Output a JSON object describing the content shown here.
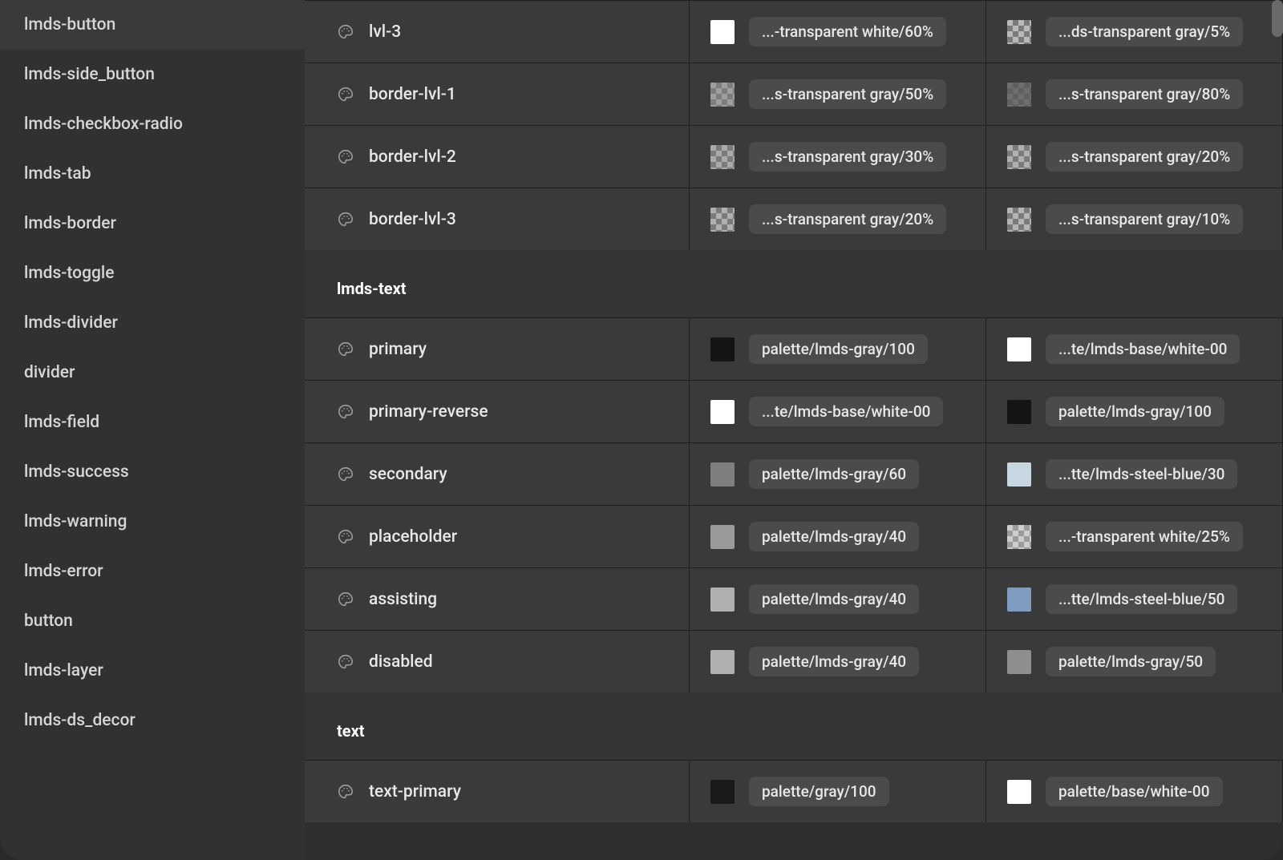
{
  "sidebar": {
    "items": [
      "lmds-button",
      "lmds-side_button",
      "lmds-checkbox-radio",
      "lmds-tab",
      "lmds-border",
      "lmds-toggle",
      "lmds-divider",
      "divider",
      "lmds-field",
      "lmds-success",
      "lmds-warning",
      "lmds-error",
      "button",
      "lmds-layer",
      "lmds-ds_decor"
    ]
  },
  "sections": [
    {
      "header": null,
      "rows": [
        {
          "name": "lvl-3",
          "col1": {
            "swatchType": "solid",
            "color": "#ffffff",
            "chip": "...-transparent white/60%"
          },
          "col2": {
            "swatchType": "checker",
            "overlay": "rgba(128,128,128,0.05)",
            "chip": "...ds-transparent gray/5%"
          }
        },
        {
          "name": "border-lvl-1",
          "col1": {
            "swatchType": "checker",
            "overlay": "rgba(128,128,128,0.5)",
            "chip": "...s-transparent gray/50%"
          },
          "col2": {
            "swatchType": "checker",
            "overlay": "rgba(90,90,90,0.8)",
            "chip": "...s-transparent gray/80%"
          }
        },
        {
          "name": "border-lvl-2",
          "col1": {
            "swatchType": "checker",
            "overlay": "rgba(128,128,128,0.3)",
            "chip": "...s-transparent gray/30%"
          },
          "col2": {
            "swatchType": "checker",
            "overlay": "rgba(128,128,128,0.2)",
            "chip": "...s-transparent gray/20%"
          }
        },
        {
          "name": "border-lvl-3",
          "col1": {
            "swatchType": "checker",
            "overlay": "rgba(128,128,128,0.2)",
            "chip": "...s-transparent gray/20%"
          },
          "col2": {
            "swatchType": "checker",
            "overlay": "rgba(128,128,128,0.1)",
            "chip": "...s-transparent gray/10%"
          }
        }
      ]
    },
    {
      "header": "lmds-text",
      "rows": [
        {
          "name": "primary",
          "col1": {
            "swatchType": "solid",
            "color": "#141414",
            "chip": "palette/lmds-gray/100"
          },
          "col2": {
            "swatchType": "solid",
            "color": "#ffffff",
            "chip": "...te/lmds-base/white-00"
          }
        },
        {
          "name": "primary-reverse",
          "col1": {
            "swatchType": "solid",
            "color": "#ffffff",
            "chip": "...te/lmds-base/white-00"
          },
          "col2": {
            "swatchType": "solid",
            "color": "#141414",
            "chip": "palette/lmds-gray/100"
          }
        },
        {
          "name": "secondary",
          "col1": {
            "swatchType": "solid",
            "color": "#7f7f7f",
            "chip": "palette/lmds-gray/60"
          },
          "col2": {
            "swatchType": "solid",
            "color": "#c7d7e2",
            "chip": "...tte/lmds-steel-blue/30"
          }
        },
        {
          "name": "placeholder",
          "col1": {
            "swatchType": "solid",
            "color": "#9a9a9a",
            "chip": "palette/lmds-gray/40"
          },
          "col2": {
            "swatchType": "checker",
            "overlay": "rgba(255,255,255,0.25)",
            "chip": "...-transparent white/25%"
          }
        },
        {
          "name": "assisting",
          "col1": {
            "swatchType": "solid",
            "color": "#b0b0b0",
            "chip": "palette/lmds-gray/40"
          },
          "col2": {
            "swatchType": "solid",
            "color": "#7d9cc0",
            "chip": "...tte/lmds-steel-blue/50"
          }
        },
        {
          "name": "disabled",
          "col1": {
            "swatchType": "solid",
            "color": "#b0b0b0",
            "chip": "palette/lmds-gray/40"
          },
          "col2": {
            "swatchType": "solid",
            "color": "#8e8e8e",
            "chip": "palette/lmds-gray/50"
          }
        }
      ]
    },
    {
      "header": "text",
      "rows": [
        {
          "name": "text-primary",
          "col1": {
            "swatchType": "solid",
            "color": "#1a1a1a",
            "chip": "palette/gray/100"
          },
          "col2": {
            "swatchType": "solid",
            "color": "#ffffff",
            "chip": "palette/base/white-00"
          }
        }
      ]
    }
  ]
}
